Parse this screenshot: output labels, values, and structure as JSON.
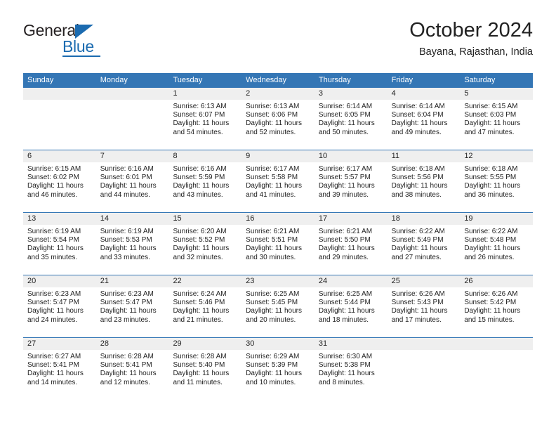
{
  "brand": {
    "name_top": "General",
    "name_bottom": "Blue",
    "accent_color": "#1b6bb0"
  },
  "header": {
    "title": "October 2024",
    "subtitle": "Bayana, Rajasthan, India"
  },
  "theme": {
    "header_blue": "#3476b5",
    "day_band_gray": "#efefef",
    "text": "#222222"
  },
  "weekdays": [
    "Sunday",
    "Monday",
    "Tuesday",
    "Wednesday",
    "Thursday",
    "Friday",
    "Saturday"
  ],
  "weeks": [
    [
      {
        "day": "",
        "sunrise": "",
        "sunset": "",
        "daylight_line1": "",
        "daylight_line2": ""
      },
      {
        "day": "",
        "sunrise": "",
        "sunset": "",
        "daylight_line1": "",
        "daylight_line2": ""
      },
      {
        "day": "1",
        "sunrise": "Sunrise: 6:13 AM",
        "sunset": "Sunset: 6:07 PM",
        "daylight_line1": "Daylight: 11 hours",
        "daylight_line2": "and 54 minutes."
      },
      {
        "day": "2",
        "sunrise": "Sunrise: 6:13 AM",
        "sunset": "Sunset: 6:06 PM",
        "daylight_line1": "Daylight: 11 hours",
        "daylight_line2": "and 52 minutes."
      },
      {
        "day": "3",
        "sunrise": "Sunrise: 6:14 AM",
        "sunset": "Sunset: 6:05 PM",
        "daylight_line1": "Daylight: 11 hours",
        "daylight_line2": "and 50 minutes."
      },
      {
        "day": "4",
        "sunrise": "Sunrise: 6:14 AM",
        "sunset": "Sunset: 6:04 PM",
        "daylight_line1": "Daylight: 11 hours",
        "daylight_line2": "and 49 minutes."
      },
      {
        "day": "5",
        "sunrise": "Sunrise: 6:15 AM",
        "sunset": "Sunset: 6:03 PM",
        "daylight_line1": "Daylight: 11 hours",
        "daylight_line2": "and 47 minutes."
      }
    ],
    [
      {
        "day": "6",
        "sunrise": "Sunrise: 6:15 AM",
        "sunset": "Sunset: 6:02 PM",
        "daylight_line1": "Daylight: 11 hours",
        "daylight_line2": "and 46 minutes."
      },
      {
        "day": "7",
        "sunrise": "Sunrise: 6:16 AM",
        "sunset": "Sunset: 6:01 PM",
        "daylight_line1": "Daylight: 11 hours",
        "daylight_line2": "and 44 minutes."
      },
      {
        "day": "8",
        "sunrise": "Sunrise: 6:16 AM",
        "sunset": "Sunset: 5:59 PM",
        "daylight_line1": "Daylight: 11 hours",
        "daylight_line2": "and 43 minutes."
      },
      {
        "day": "9",
        "sunrise": "Sunrise: 6:17 AM",
        "sunset": "Sunset: 5:58 PM",
        "daylight_line1": "Daylight: 11 hours",
        "daylight_line2": "and 41 minutes."
      },
      {
        "day": "10",
        "sunrise": "Sunrise: 6:17 AM",
        "sunset": "Sunset: 5:57 PM",
        "daylight_line1": "Daylight: 11 hours",
        "daylight_line2": "and 39 minutes."
      },
      {
        "day": "11",
        "sunrise": "Sunrise: 6:18 AM",
        "sunset": "Sunset: 5:56 PM",
        "daylight_line1": "Daylight: 11 hours",
        "daylight_line2": "and 38 minutes."
      },
      {
        "day": "12",
        "sunrise": "Sunrise: 6:18 AM",
        "sunset": "Sunset: 5:55 PM",
        "daylight_line1": "Daylight: 11 hours",
        "daylight_line2": "and 36 minutes."
      }
    ],
    [
      {
        "day": "13",
        "sunrise": "Sunrise: 6:19 AM",
        "sunset": "Sunset: 5:54 PM",
        "daylight_line1": "Daylight: 11 hours",
        "daylight_line2": "and 35 minutes."
      },
      {
        "day": "14",
        "sunrise": "Sunrise: 6:19 AM",
        "sunset": "Sunset: 5:53 PM",
        "daylight_line1": "Daylight: 11 hours",
        "daylight_line2": "and 33 minutes."
      },
      {
        "day": "15",
        "sunrise": "Sunrise: 6:20 AM",
        "sunset": "Sunset: 5:52 PM",
        "daylight_line1": "Daylight: 11 hours",
        "daylight_line2": "and 32 minutes."
      },
      {
        "day": "16",
        "sunrise": "Sunrise: 6:21 AM",
        "sunset": "Sunset: 5:51 PM",
        "daylight_line1": "Daylight: 11 hours",
        "daylight_line2": "and 30 minutes."
      },
      {
        "day": "17",
        "sunrise": "Sunrise: 6:21 AM",
        "sunset": "Sunset: 5:50 PM",
        "daylight_line1": "Daylight: 11 hours",
        "daylight_line2": "and 29 minutes."
      },
      {
        "day": "18",
        "sunrise": "Sunrise: 6:22 AM",
        "sunset": "Sunset: 5:49 PM",
        "daylight_line1": "Daylight: 11 hours",
        "daylight_line2": "and 27 minutes."
      },
      {
        "day": "19",
        "sunrise": "Sunrise: 6:22 AM",
        "sunset": "Sunset: 5:48 PM",
        "daylight_line1": "Daylight: 11 hours",
        "daylight_line2": "and 26 minutes."
      }
    ],
    [
      {
        "day": "20",
        "sunrise": "Sunrise: 6:23 AM",
        "sunset": "Sunset: 5:47 PM",
        "daylight_line1": "Daylight: 11 hours",
        "daylight_line2": "and 24 minutes."
      },
      {
        "day": "21",
        "sunrise": "Sunrise: 6:23 AM",
        "sunset": "Sunset: 5:47 PM",
        "daylight_line1": "Daylight: 11 hours",
        "daylight_line2": "and 23 minutes."
      },
      {
        "day": "22",
        "sunrise": "Sunrise: 6:24 AM",
        "sunset": "Sunset: 5:46 PM",
        "daylight_line1": "Daylight: 11 hours",
        "daylight_line2": "and 21 minutes."
      },
      {
        "day": "23",
        "sunrise": "Sunrise: 6:25 AM",
        "sunset": "Sunset: 5:45 PM",
        "daylight_line1": "Daylight: 11 hours",
        "daylight_line2": "and 20 minutes."
      },
      {
        "day": "24",
        "sunrise": "Sunrise: 6:25 AM",
        "sunset": "Sunset: 5:44 PM",
        "daylight_line1": "Daylight: 11 hours",
        "daylight_line2": "and 18 minutes."
      },
      {
        "day": "25",
        "sunrise": "Sunrise: 6:26 AM",
        "sunset": "Sunset: 5:43 PM",
        "daylight_line1": "Daylight: 11 hours",
        "daylight_line2": "and 17 minutes."
      },
      {
        "day": "26",
        "sunrise": "Sunrise: 6:26 AM",
        "sunset": "Sunset: 5:42 PM",
        "daylight_line1": "Daylight: 11 hours",
        "daylight_line2": "and 15 minutes."
      }
    ],
    [
      {
        "day": "27",
        "sunrise": "Sunrise: 6:27 AM",
        "sunset": "Sunset: 5:41 PM",
        "daylight_line1": "Daylight: 11 hours",
        "daylight_line2": "and 14 minutes."
      },
      {
        "day": "28",
        "sunrise": "Sunrise: 6:28 AM",
        "sunset": "Sunset: 5:41 PM",
        "daylight_line1": "Daylight: 11 hours",
        "daylight_line2": "and 12 minutes."
      },
      {
        "day": "29",
        "sunrise": "Sunrise: 6:28 AM",
        "sunset": "Sunset: 5:40 PM",
        "daylight_line1": "Daylight: 11 hours",
        "daylight_line2": "and 11 minutes."
      },
      {
        "day": "30",
        "sunrise": "Sunrise: 6:29 AM",
        "sunset": "Sunset: 5:39 PM",
        "daylight_line1": "Daylight: 11 hours",
        "daylight_line2": "and 10 minutes."
      },
      {
        "day": "31",
        "sunrise": "Sunrise: 6:30 AM",
        "sunset": "Sunset: 5:38 PM",
        "daylight_line1": "Daylight: 11 hours",
        "daylight_line2": "and 8 minutes."
      },
      {
        "day": "",
        "sunrise": "",
        "sunset": "",
        "daylight_line1": "",
        "daylight_line2": ""
      },
      {
        "day": "",
        "sunrise": "",
        "sunset": "",
        "daylight_line1": "",
        "daylight_line2": ""
      }
    ]
  ]
}
